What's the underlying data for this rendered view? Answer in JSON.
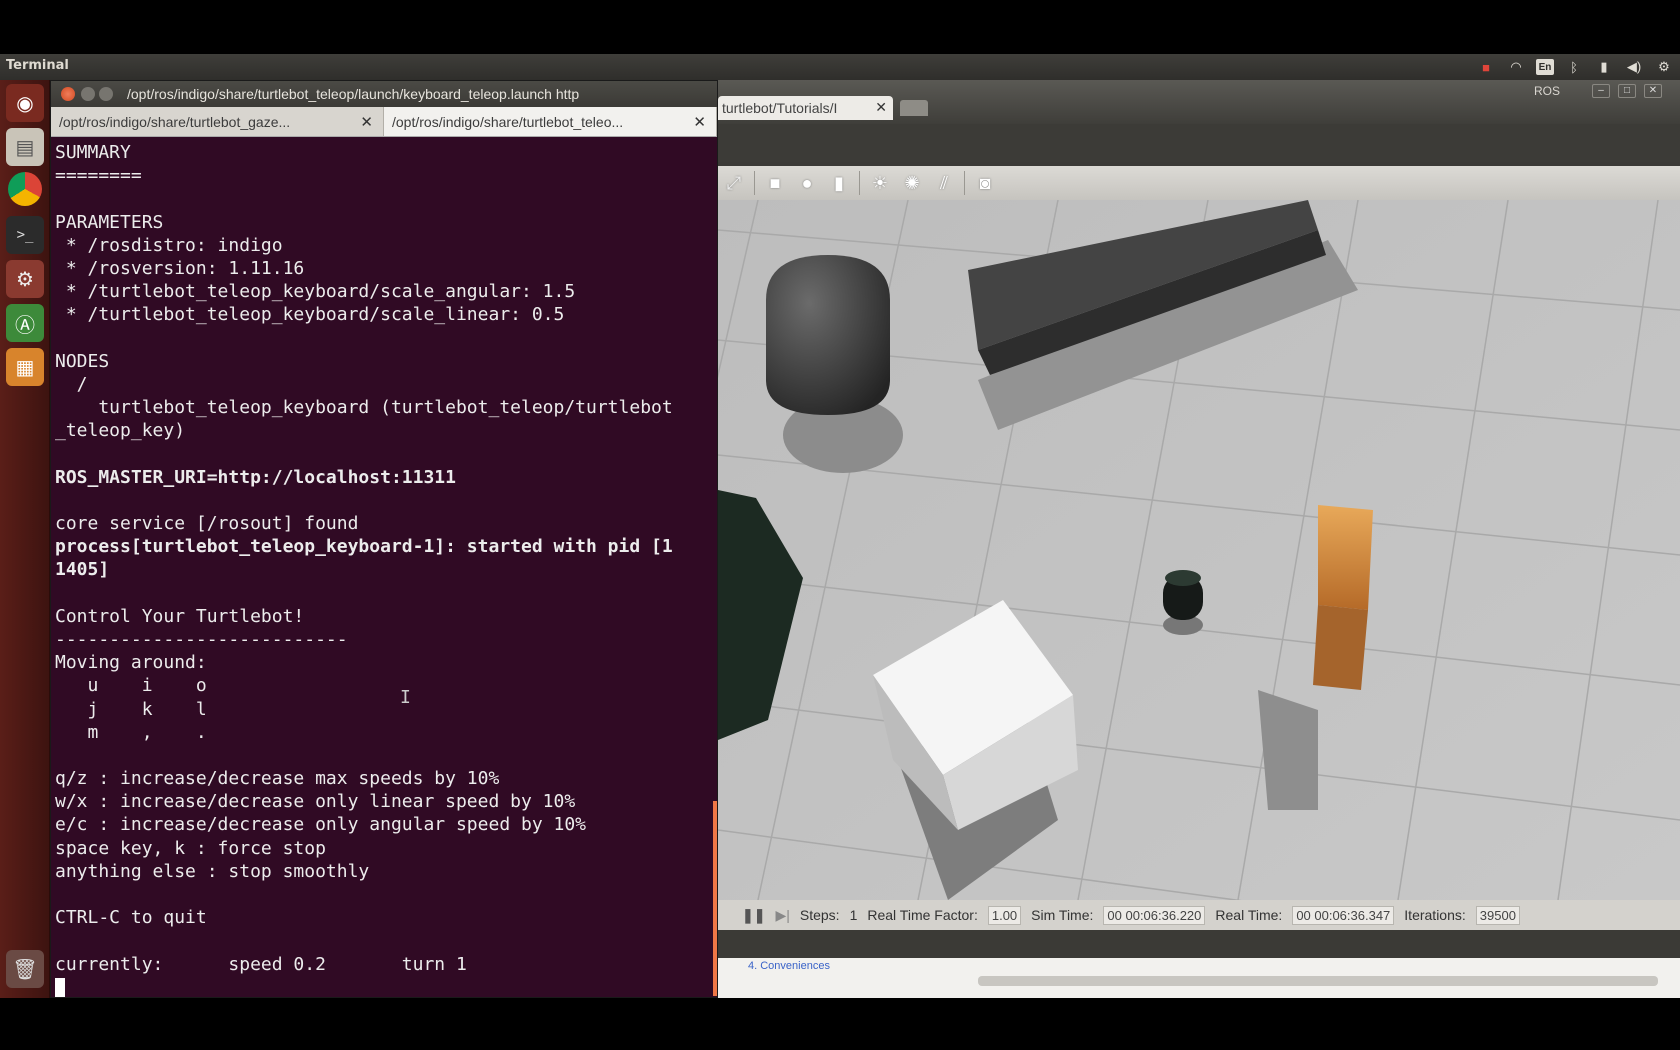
{
  "topbar": {
    "app_title": "Terminal",
    "lang_indicator": "En",
    "icons": [
      "camera-icon",
      "wifi-icon",
      "keyboard-layout-icon",
      "bluetooth-icon",
      "battery-icon",
      "volume-icon",
      "settings-gear-icon"
    ]
  },
  "launcher": {
    "items": [
      "dash-home-icon",
      "files-icon",
      "chrome-icon",
      "terminal-icon",
      "system-settings-icon",
      "software-updater-icon",
      "package-icon",
      "trash-icon"
    ]
  },
  "terminal": {
    "window_title": "/opt/ros/indigo/share/turtlebot_teleop/launch/keyboard_teleop.launch http",
    "tabs": [
      {
        "label": "/opt/ros/indigo/share/turtlebot_gaze..."
      },
      {
        "label": "/opt/ros/indigo/share/turtlebot_teleo..."
      }
    ],
    "lines": [
      "SUMMARY",
      "========",
      "",
      "PARAMETERS",
      " * /rosdistro: indigo",
      " * /rosversion: 1.11.16",
      " * /turtlebot_teleop_keyboard/scale_angular: 1.5",
      " * /turtlebot_teleop_keyboard/scale_linear: 0.5",
      "",
      "NODES",
      "  /",
      "    turtlebot_teleop_keyboard (turtlebot_teleop/turtlebot",
      "_teleop_key)",
      "",
      "ROS_MASTER_URI=http://localhost:11311",
      "",
      "core service [/rosout] found",
      "process[turtlebot_teleop_keyboard-1]: started with pid [1",
      "1405]",
      "",
      "Control Your Turtlebot!",
      "---------------------------",
      "Moving around:",
      "   u    i    o",
      "   j    k    l",
      "   m    ,    .",
      "",
      "q/z : increase/decrease max speeds by 10%",
      "w/x : increase/decrease only linear speed by 10%",
      "e/c : increase/decrease only angular speed by 10%",
      "space key, k : force stop",
      "anything else : stop smoothly",
      "",
      "CTRL-C to quit",
      "",
      "currently:      speed 0.2       turn 1"
    ]
  },
  "gazebo": {
    "tab_label": "turtlebot/Tutorials/I",
    "tray_label": "ROS",
    "status": {
      "steps_label": "Steps:",
      "steps_value": "1",
      "rtf_label": "Real Time Factor:",
      "rtf_value": "1.00",
      "sim_time_label": "Sim Time:",
      "sim_time_value": "00 00:06:36.220",
      "real_time_label": "Real Time:",
      "real_time_value": "00 00:06:36.347",
      "iterations_label": "Iterations:",
      "iterations_value": "39500"
    },
    "link_text": "4. Conveniences"
  }
}
